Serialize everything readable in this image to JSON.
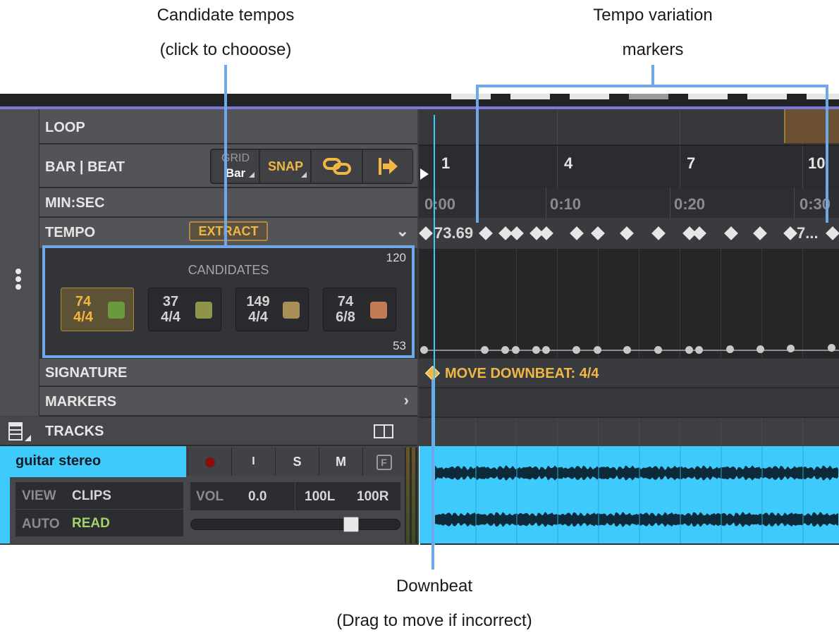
{
  "callouts": {
    "candidate_line1": "Candidate tempos",
    "candidate_line2": "(click to chooose)",
    "variation_line1": "Tempo variation",
    "variation_line2": "markers",
    "downbeat_line1": "Downbeat",
    "downbeat_line2": "(Drag to move if incorrect)"
  },
  "rows": {
    "loop": "LOOP",
    "barbeat": "BAR | BEAT",
    "minsec": "MIN:SEC",
    "tempo": "TEMPO",
    "signature": "SIGNATURE",
    "markers": "MARKERS",
    "tracks": "TRACKS"
  },
  "grid": {
    "label": "GRID",
    "value": "Bar"
  },
  "snap": {
    "label": "SNAP"
  },
  "tempo": {
    "extract_label": "EXTRACT",
    "first_marker_value": "73.69",
    "last_marker_value": "7...",
    "range_max": "120",
    "range_min": "53"
  },
  "candidates": {
    "title": "CANDIDATES",
    "items": [
      {
        "tempo": "74",
        "sig": "4/4",
        "color": "#6b9a3e",
        "selected": true
      },
      {
        "tempo": "37",
        "sig": "4/4",
        "color": "#8f944a",
        "selected": false
      },
      {
        "tempo": "149",
        "sig": "4/4",
        "color": "#a98e55",
        "selected": false
      },
      {
        "tempo": "74",
        "sig": "6/8",
        "color": "#c27b56",
        "selected": false
      }
    ]
  },
  "ruler": {
    "bars": [
      "1",
      "4",
      "7",
      "10"
    ],
    "seconds": [
      "0:00",
      "0:10",
      "0:20",
      "0:30"
    ]
  },
  "signature": {
    "move_label": "MOVE DOWNBEAT: 4/4"
  },
  "track": {
    "name": "guitar stereo",
    "buttons": {
      "input": "I",
      "solo": "S",
      "mute": "M",
      "freeze": "F"
    },
    "view_label": "VIEW",
    "view_value": "CLIPS",
    "auto_label": "AUTO",
    "auto_value": "READ",
    "vol_label": "VOL",
    "vol_value": "0.0",
    "pan_left": "100L",
    "pan_right": "100R",
    "fader_level": 0.79
  },
  "colors": {
    "accent": "#f0b744",
    "track": "#3ecbfb",
    "callout_line": "#6fa8e8",
    "purple_bar": "#7d78d8"
  },
  "icons": {
    "link": "link-icon",
    "follow": "arrow-right-bar-icon",
    "chevron": "chevron-down-icon",
    "more": "vertical-ellipsis-icon",
    "record": "record-icon"
  }
}
